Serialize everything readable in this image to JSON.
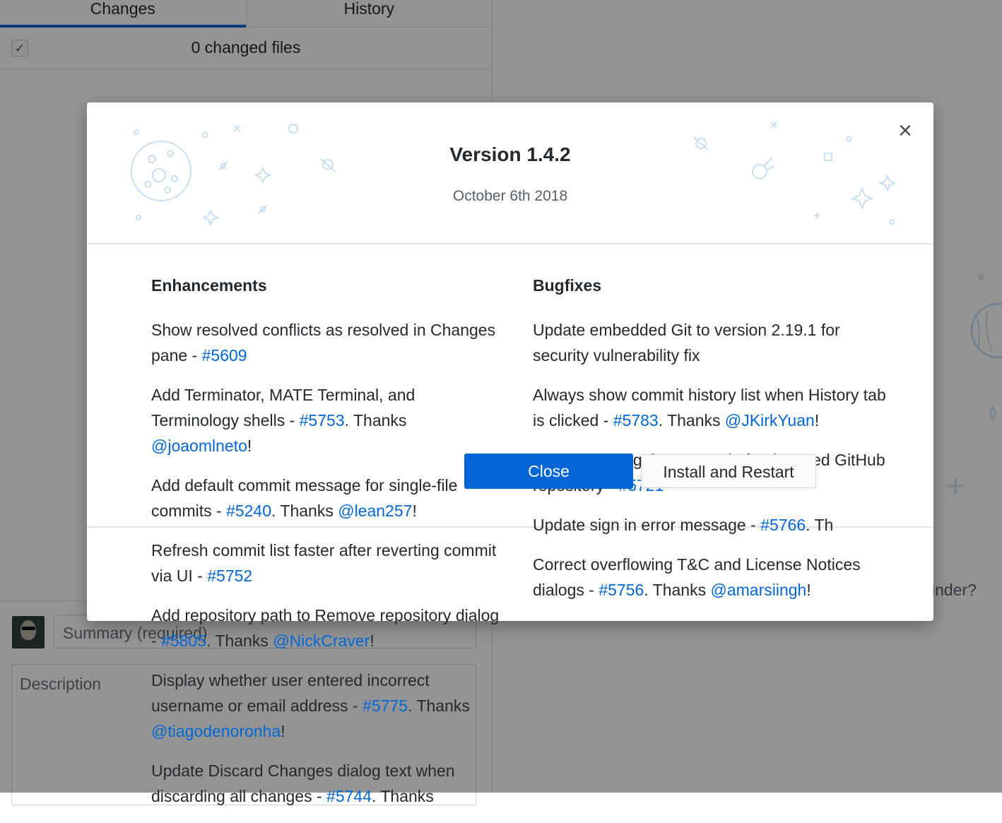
{
  "tabs": [
    {
      "label": "Changes",
      "selected": true
    },
    {
      "label": "History",
      "selected": false
    }
  ],
  "changes": {
    "count_label": "0 changed files",
    "checkbox_glyph": "✓"
  },
  "commit": {
    "summary_placeholder": "Summary (required)",
    "description_placeholder": "Description"
  },
  "right_pane": {
    "partial_text": "inder?"
  },
  "dialog": {
    "title": "Version 1.4.2",
    "date": "October 6th 2018",
    "close_icon": "×",
    "enhancements_heading": "Enhancements",
    "bugfixes_heading": "Bugfixes",
    "enhancements": [
      {
        "text": "Show resolved conflicts as resolved in Changes pane - ",
        "link": "#5609",
        "thanks_prefix": "",
        "thanks_user": "",
        "suffix": ""
      },
      {
        "text": "Add Terminator, MATE Terminal, and Terminology shells - ",
        "link": "#5753",
        "thanks_prefix": ". Thanks ",
        "thanks_user": "@joaomlneto",
        "suffix": "!"
      },
      {
        "text": "Add default commit message for single-file commits - ",
        "link": "#5240",
        "thanks_prefix": ". Thanks ",
        "thanks_user": "@lean257",
        "suffix": "!"
      },
      {
        "text": "Refresh commit list faster after reverting commit via UI - ",
        "link": "#5752",
        "thanks_prefix": "",
        "thanks_user": "",
        "suffix": ""
      },
      {
        "text": "Add repository path to Remove repository dialog - ",
        "link": "#5805",
        "thanks_prefix": ". Thanks ",
        "thanks_user": "@NickCraver",
        "suffix": "!"
      },
      {
        "text": "Display whether user entered incorrect username or email address - ",
        "link": "#5775",
        "thanks_prefix": ". Thanks ",
        "thanks_user": "@tiagodenoronha",
        "suffix": "!"
      },
      {
        "text": "Update Discard Changes dialog text when discarding all changes - ",
        "link": "#5744",
        "thanks_prefix": ". Thanks",
        "thanks_user": "",
        "suffix": ""
      }
    ],
    "bugfixes": [
      {
        "text": "Update embedded Git to version 2.19.1 for security vulnerability fix",
        "link": "",
        "thanks_prefix": "",
        "thanks_user": "",
        "suffix": ""
      },
      {
        "text": "Always show commit history list when History tab is clicked - ",
        "link": "#5783",
        "thanks_prefix": ". Thanks ",
        "thanks_user": "@JKirkYuan",
        "suffix": "!"
      },
      {
        "text": "Stop overriding the protocol of a detected GitHub repository - ",
        "link": "#5721",
        "thanks_prefix": "",
        "thanks_user": "",
        "suffix": ""
      },
      {
        "text": "Update sign in error message - ",
        "link": "#5766",
        "thanks_prefix": ". Th",
        "thanks_user": "",
        "suffix": ""
      },
      {
        "text": "Correct overflowing T&C and License Notices dialogs - ",
        "link": "#5756",
        "thanks_prefix": ". Thanks ",
        "thanks_user": "@amarsiingh",
        "suffix": "!"
      }
    ],
    "close_button": "Close",
    "install_button": "Install and Restart"
  },
  "colors": {
    "accent": "#0366d6",
    "text": "#24292e",
    "muted": "#586069",
    "overlay": "rgba(0,0,0,0.42)",
    "decoration": "#c8dff4"
  }
}
